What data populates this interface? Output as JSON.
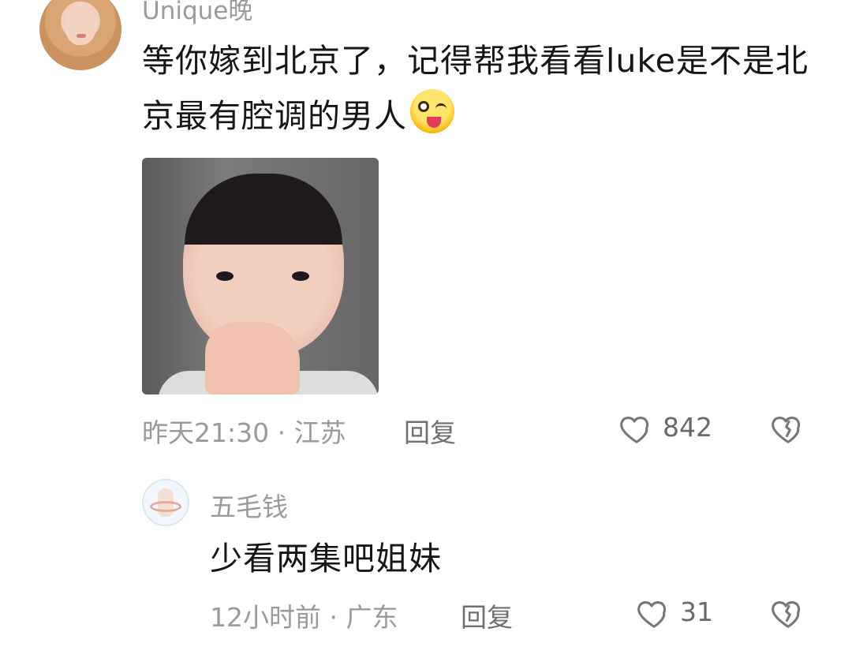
{
  "comments": [
    {
      "username": "Unique晚",
      "text": "等你嫁到北京了，记得帮我看看luke是不是北京最有腔调的男人",
      "emoji": "winking-face-with-tongue",
      "has_image": true,
      "time": "昨天21:30",
      "sep": "·",
      "location": "江苏",
      "reply_label": "回复",
      "likes": "842"
    },
    {
      "username": "五毛钱",
      "text": "少看两集吧姐妹",
      "time": "12小时前",
      "sep": "·",
      "location": "广东",
      "reply_label": "回复",
      "likes": "31"
    }
  ],
  "colors": {
    "meta": "#9a9a9a",
    "text": "#161616",
    "icon": "#777777"
  }
}
